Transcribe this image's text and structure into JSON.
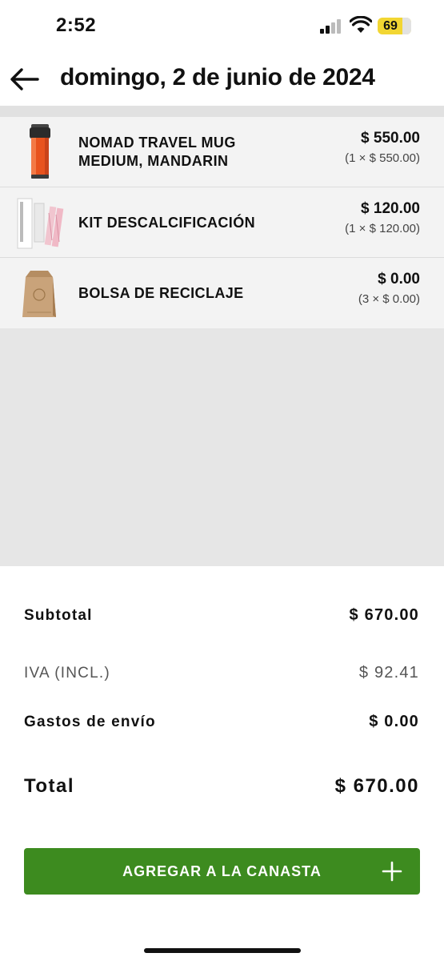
{
  "status_bar": {
    "time": "2:52",
    "battery": "69",
    "icons": [
      "signal-icon",
      "wifi-icon",
      "battery-icon"
    ]
  },
  "header": {
    "title": "domingo, 2 de junio de 2024",
    "back_icon": "arrow-left-icon"
  },
  "items": [
    {
      "name": "NOMAD TRAVEL MUG MEDIUM, MANDARIN",
      "price": "$ 550.00",
      "unit": "(1 × $ 550.00)",
      "thumb": "orange-travel-mug"
    },
    {
      "name": "KIT DESCALCIFICACIÓN",
      "price": "$ 120.00",
      "unit": "(1 × $ 120.00)",
      "thumb": "descaling-kit"
    },
    {
      "name": "BOLSA DE RECICLAJE",
      "price": "$ 0.00",
      "unit": "(3 × $ 0.00)",
      "thumb": "recycling-bag"
    }
  ],
  "summary": {
    "subtotal_label": "Subtotal",
    "subtotal_value": "$ 670.00",
    "iva_label": "IVA (INCL.)",
    "iva_value": "$ 92.41",
    "shipping_label": "Gastos de envío",
    "shipping_value": "$ 0.00",
    "total_label": "Total",
    "total_value": "$ 670.00"
  },
  "action": {
    "add_label": "AGREGAR A LA CANASTA",
    "add_icon": "plus-icon"
  },
  "colors": {
    "accent_green": "#3d8b1f",
    "mug_orange": "#e8531e",
    "battery_yellow": "#f2d633"
  }
}
